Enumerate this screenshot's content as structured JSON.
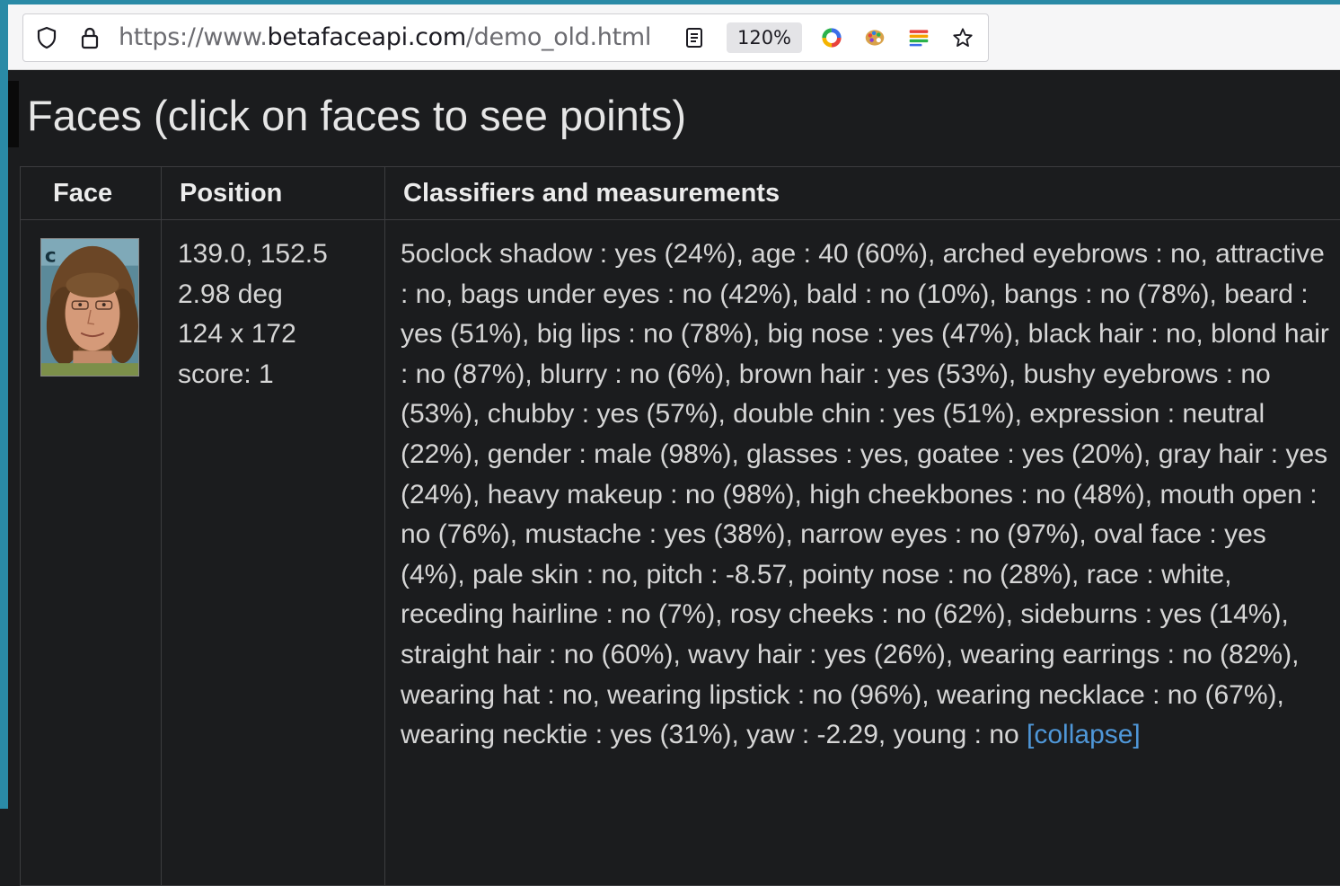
{
  "browser": {
    "url_scheme": "https://www.",
    "url_host": "betafaceapi.com",
    "url_path": "/demo_old.html",
    "zoom_level": "120%"
  },
  "page": {
    "title": "Faces (click on faces to see points)"
  },
  "table": {
    "headers": [
      "Face",
      "Position",
      "Classifiers and measurements"
    ],
    "rows": [
      {
        "position": [
          "139.0, 152.5",
          "2.98 deg",
          "124 x 172",
          "score: 1"
        ],
        "classifiers_text": "5oclock shadow : yes (24%), age : 40 (60%), arched eyebrows : no, attractive : no, bags under eyes : no (42%), bald : no (10%), bangs : no (78%), beard : yes (51%), big lips : no (78%), big nose : yes (47%), black hair : no, blond hair : no (87%), blurry : no (6%), brown hair : yes (53%), bushy eyebrows : no (53%), chubby : yes (57%), double chin : yes (51%), expression : neutral (22%), gender : male (98%), glasses : yes, goatee : yes (20%), gray hair : yes (24%), heavy makeup : no (98%), high cheekbones : no (48%), mouth open : no (76%), mustache : yes (38%), narrow eyes : no (97%), oval face : yes (4%), pale skin : no, pitch : -8.57, pointy nose : no (28%), race : white, receding hairline : no (7%), rosy cheeks : no (62%), sideburns : yes (14%), straight hair : no (60%), wavy hair : yes (26%), wearing earrings : no (82%), wearing hat : no, wearing lipstick : no (96%), wearing necklace : no (67%), wearing necktie : yes (31%), yaw : -2.29, young : no",
        "collapse_label": "[collapse]"
      }
    ]
  }
}
